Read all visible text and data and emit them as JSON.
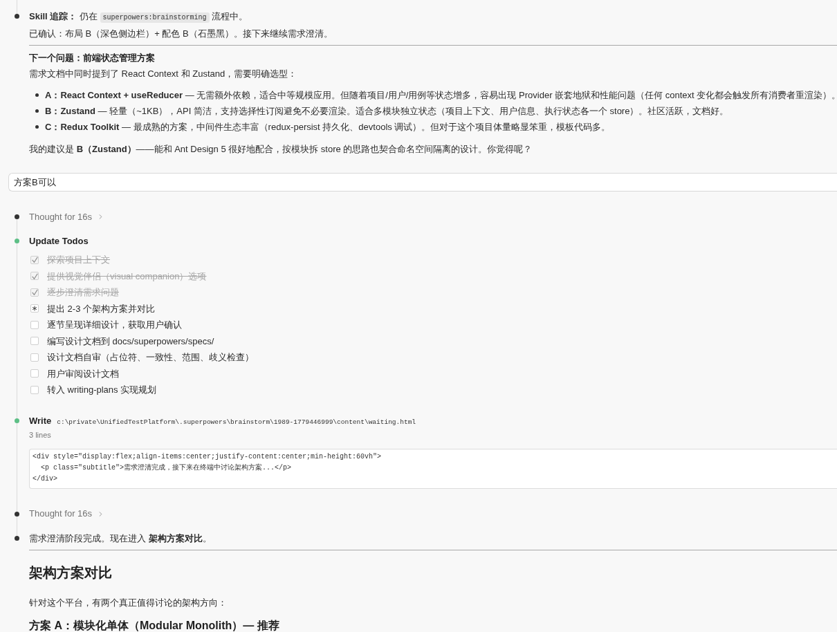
{
  "conversation": [
    {
      "kind": "assistant",
      "color": "#333333",
      "blocks": [
        {
          "kind": "paragraph",
          "lines": [
            {
              "strong": false,
              "segments": [
                {
                  "kind": "text",
                  "text": "**Skill 追踪：** 仍在 "
                },
                {
                  "kind": "code",
                  "text": "superpowers:brainstorming"
                },
                {
                  "kind": "text",
                  "text": " 流程中。"
                }
              ]
            },
            {
              "strong": false,
              "segments": [
                {
                  "kind": "text",
                  "text": "已确认：布局 B（深色侧边栏）+ 配色 B（石墨黑）。接下来继续需求澄清。"
                }
              ]
            }
          ]
        },
        {
          "kind": "rule"
        },
        {
          "kind": "paragraph",
          "lines": [
            {
              "strong": true,
              "segments": [
                {
                  "kind": "text",
                  "text": "下一个问题：前端状态管理方案"
                }
              ]
            },
            {
              "strong": false,
              "segments": [
                {
                  "kind": "text",
                  "text": "需求文档中同时提到了 React Context 和 Zustand，需要明确选型："
                }
              ]
            }
          ]
        },
        {
          "kind": "list",
          "items": [
            "**A：React Context + useReducer** — 无需额外依赖，适合中等规模应用。但随着项目/用户/用例等状态增多，容易出现 Provider 嵌套地狱和性能问题（任何 context 变化都会触发所有消费者重渲染）。",
            "**B：Zustand** — 轻量（~1KB），API 简洁，支持选择性订阅避免不必要渲染。适合多模块独立状态（项目上下文、用户信息、执行状态各一个 store）。社区活跃，文档好。",
            "**C：Redux Toolkit** — 最成熟的方案，中间件生态丰富（redux-persist 持久化、devtools 调试）。但对于这个项目体量略显笨重，模板代码多。"
          ]
        },
        {
          "kind": "paragraph",
          "lines": [
            {
              "strong": false,
              "segments": [
                {
                  "kind": "text",
                  "text": "我的建议是 **B（Zustand）**——能和 Ant Design 5 很好地配合，按模块拆 store 的思路也契合命名空间隔离的设计。你觉得呢？"
                }
              ]
            }
          ]
        }
      ]
    },
    {
      "kind": "user_message",
      "text": "方案B可以"
    },
    {
      "kind": "thought",
      "color": "#333333",
      "label": "Thought for 16s"
    },
    {
      "kind": "todos",
      "color": "#5dbf86",
      "title": "Update Todos",
      "items": [
        {
          "text": "探索项目上下文",
          "checked": true,
          "active": false
        },
        {
          "text": "提供视觉伴侣（visual companion）选项",
          "checked": true,
          "active": false
        },
        {
          "text": "逐步澄清需求问题",
          "checked": true,
          "active": false
        },
        {
          "text": "提出 2-3 个架构方案并对比",
          "checked": false,
          "active": true
        },
        {
          "text": "逐节呈现详细设计，获取用户确认",
          "checked": false,
          "active": false
        },
        {
          "text": "编写设计文档到 docs/superpowers/specs/",
          "checked": false,
          "active": false
        },
        {
          "text": "设计文档自审（占位符、一致性、范围、歧义检查）",
          "checked": false,
          "active": false
        },
        {
          "text": "用户审阅设计文档",
          "checked": false,
          "active": false
        },
        {
          "text": "转入 writing-plans 实现规划",
          "checked": false,
          "active": false
        }
      ]
    },
    {
      "kind": "write",
      "color": "#5dbf86",
      "title": "Write",
      "path": "c:\\private\\UnifiedTestPlatform\\.superpowers\\brainstorm\\1989-1779446999\\content\\waiting.html",
      "summary": "3 lines",
      "code": [
        "<div style=\"display:flex;align-items:center;justify-content:center;min-height:60vh\">",
        "  <p class=\"subtitle\">需求澄清完成，接下来在终端中讨论架构方案...</p>",
        "</div>"
      ]
    },
    {
      "kind": "thought",
      "color": "#333333",
      "label": "Thought for 16s"
    },
    {
      "kind": "assistant",
      "color": "#333333",
      "blocks": [
        {
          "kind": "paragraph",
          "lines": [
            {
              "strong": false,
              "segments": [
                {
                  "kind": "text",
                  "text": "需求澄清阶段完成。现在进入 **架构方案对比**。"
                }
              ]
            }
          ]
        },
        {
          "kind": "rule"
        },
        {
          "kind": "heading",
          "text": "架构方案对比"
        },
        {
          "kind": "paragraph",
          "lines": [
            {
              "strong": false,
              "segments": [
                {
                  "kind": "text",
                  "text": "针对这个平台，有两个真正值得讨论的架构方向："
                }
              ]
            }
          ]
        },
        {
          "kind": "subheading",
          "text": "方案 A：模块化单体（Modular Monolith）— 推荐"
        }
      ]
    }
  ]
}
